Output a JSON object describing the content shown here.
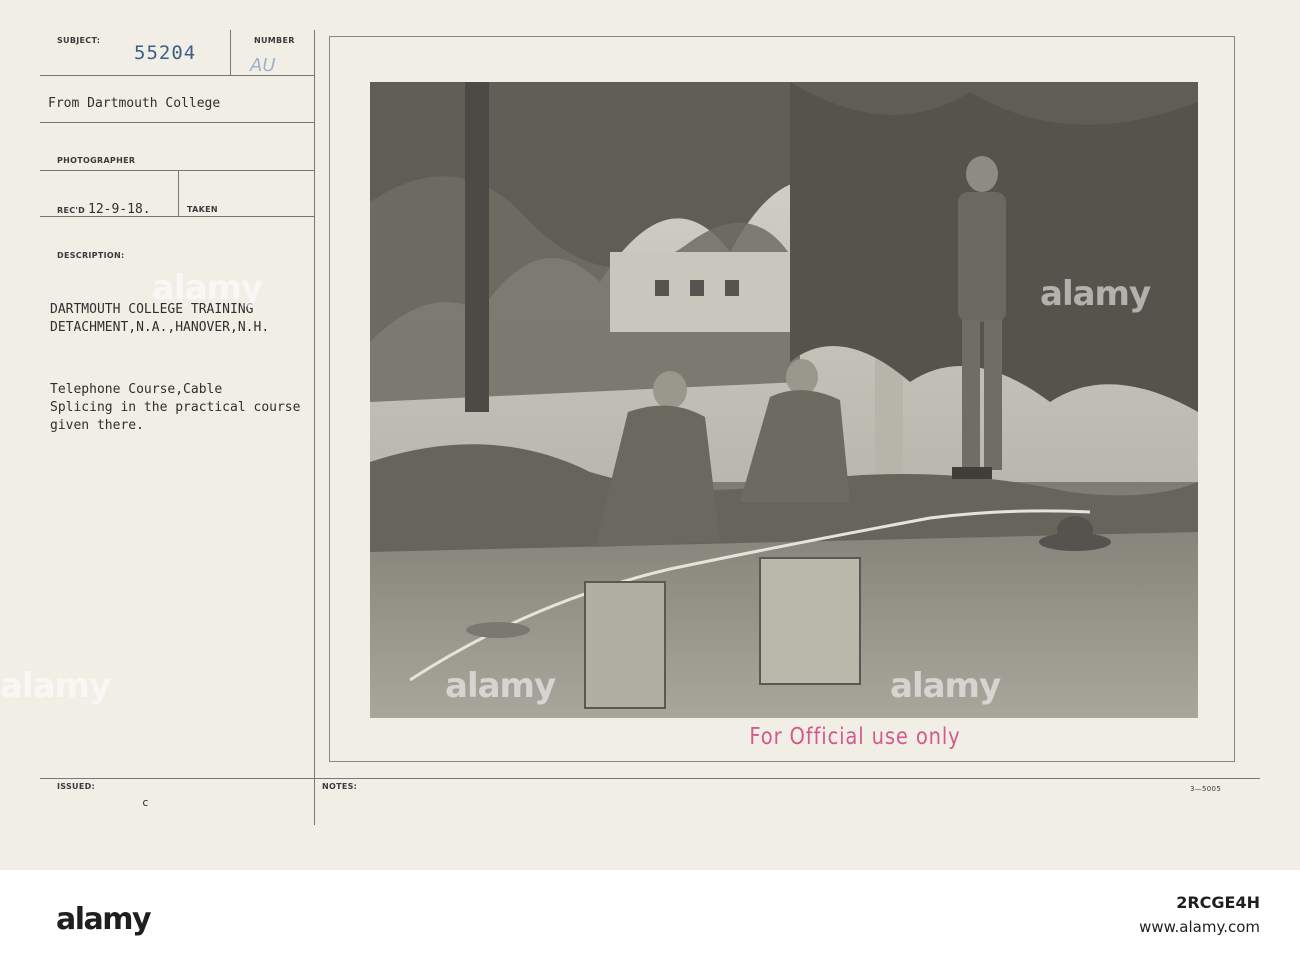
{
  "card": {
    "labels": {
      "subject": "SUBJECT:",
      "number": "NUMBER",
      "photographer": "PHOTOGRAPHER",
      "taken": "TAKEN",
      "description": "DESCRIPTION:",
      "issued": "ISSUED:",
      "notes": "NOTES:"
    },
    "subject_number": "55204",
    "number_stamp": "AU",
    "source": "From Dartmouth College",
    "recd_prefix": "REC'D",
    "recd_date": "12-9-18.",
    "description_lines": [
      "DARTMOUTH COLLEGE TRAINING",
      "DETACHMENT,N.A.,HANOVER,N.H.",
      "",
      "Telephone Course,Cable",
      "Splicing in the practical course",
      "given there."
    ],
    "issued_mark": "c",
    "form_code": "3—5005",
    "stamp_official": "For Official use only"
  },
  "watermark": {
    "text": "alamy"
  },
  "footer": {
    "logo": "alamy",
    "image_id": "2RCGE4H",
    "url": "www.alamy.com"
  },
  "colors": {
    "card_bg": "#f1eee6",
    "ink": "#2f2f2f",
    "stamp_blue": "#3d5f86",
    "stamp_pink": "#d25a90"
  }
}
